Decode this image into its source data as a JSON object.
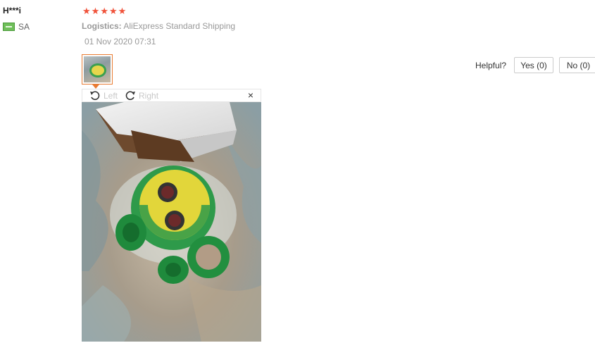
{
  "review": {
    "user_name": "H***i",
    "country_code": "SA",
    "rating": 5,
    "logistics_label": "Logistics:",
    "logistics_value": "AliExpress Standard Shipping",
    "date": "01 Nov 2020 07:31"
  },
  "viewer": {
    "rotate_left": "Left",
    "rotate_right": "Right",
    "close": "×"
  },
  "feedback": {
    "helpful_label": "Helpful?",
    "yes_label": "Yes (0)",
    "no_label": "No (0)"
  },
  "colors": {
    "star": "#f0523a",
    "thumb_border": "#e87b32"
  }
}
